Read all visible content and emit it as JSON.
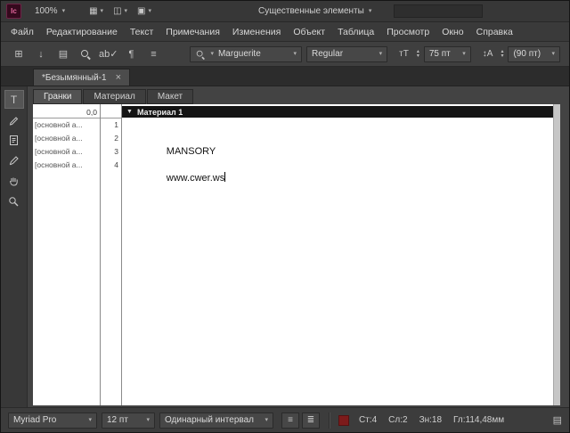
{
  "icons": {
    "chevron_down": "▾",
    "stepper_up": "▴",
    "stepper_down": "▾",
    "collapse_triangle": "▼",
    "close": "×",
    "type_tool": "T"
  },
  "brand_colors": {
    "incopy_icon_bg": "#35091d",
    "incopy_icon_fg": "#e2679c",
    "copyfit_indicator": "#7d1b1b"
  },
  "titlebar": {
    "app_icon_text": "Ic",
    "zoom_value": "100%",
    "view_options_glyph": "▦",
    "screen_mode_glyph": "◫",
    "arrange_docs_glyph": "▣",
    "workspace": "Существенные элементы",
    "search_value": ""
  },
  "menubar": {
    "items": [
      "Файл",
      "Редактирование",
      "Текст",
      "Примечания",
      "Изменения",
      "Объект",
      "Таблица",
      "Просмотр",
      "Окно",
      "Справка"
    ]
  },
  "toolbar": {
    "icons_left": [
      {
        "name": "new-document-icon",
        "glyph": "⊞"
      },
      {
        "name": "place-file-icon",
        "glyph": "↓"
      },
      {
        "name": "print-icon",
        "glyph": "▤"
      }
    ],
    "icons_right": [
      {
        "name": "spellcheck-icon",
        "glyph": "ab✓"
      },
      {
        "name": "hidden-characters-icon",
        "glyph": "¶"
      },
      {
        "name": "text-options-icon",
        "glyph": "≡"
      }
    ],
    "font_family": "Marguerite",
    "font_style": "Regular",
    "char_size_glyph": "тT",
    "font_size": "75 пт",
    "leading_glyph": "↕A",
    "leading_value": "(90 пт)"
  },
  "document_tab": {
    "title": "*Безымянный-1"
  },
  "view_tabs": [
    {
      "label": "Гранки",
      "active": true
    },
    {
      "label": "Материал"
    },
    {
      "label": "Макет"
    }
  ],
  "tools": [
    "type-tool",
    "notes-tool",
    "note-tool",
    "eyedropper-tool",
    "hand-tool",
    "zoom-tool"
  ],
  "galley": {
    "ruler_value": "0,0",
    "story_header": "Материал 1",
    "lines": [
      {
        "style": "[основной а...",
        "num": "1",
        "text": ""
      },
      {
        "style": "[основной а...",
        "num": "2",
        "text": "MANSORY"
      },
      {
        "style": "[основной а...",
        "num": "3",
        "text": ""
      },
      {
        "style": "[основной а...",
        "num": "4",
        "text": "www.cwer.ws",
        "caret": true
      }
    ]
  },
  "statusbar": {
    "font_family": "Myriad Pro",
    "font_size": "12 пт",
    "line_spacing": "Одинарный интервал",
    "icon_buttons": [
      {
        "name": "galley-marks-icon",
        "glyph": "≡"
      },
      {
        "name": "line-info-icon",
        "glyph": "≣"
      }
    ],
    "stats": [
      "Ст:4",
      "Сл:2",
      "Зн:18",
      "Гл:114,48мм"
    ],
    "right_icon_glyph": "▤"
  }
}
